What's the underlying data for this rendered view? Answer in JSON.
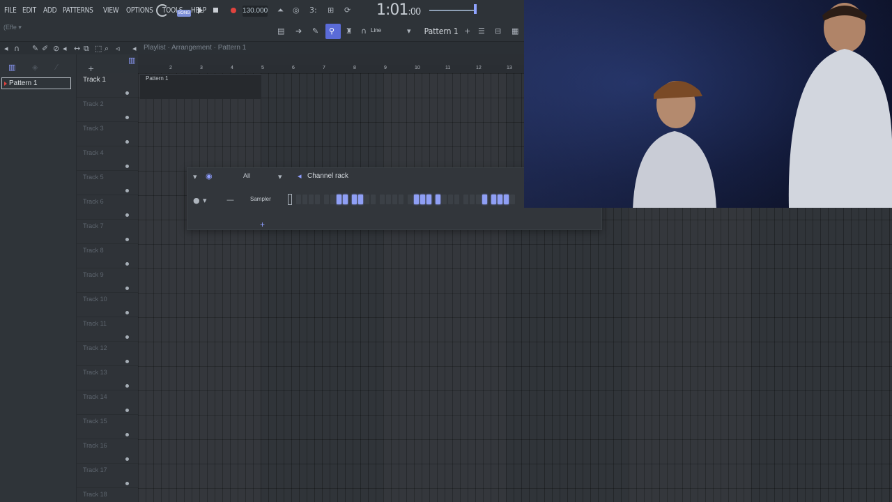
{
  "menu": [
    "FILE",
    "EDIT",
    "ADD",
    "PATTERNS",
    "VIEW",
    "OPTIONS",
    "TOOLS",
    "HELP"
  ],
  "transport": {
    "mode_label": "SONG",
    "tempo": "130.000",
    "time_main": "1:01",
    "time_sub": ":00"
  },
  "toolbar": {
    "snap_mode": "Line",
    "pattern_selected": "Pattern 1",
    "left_label": "(Effe ▾"
  },
  "playlist": {
    "breadcrumb": "Playlist · Arrangement · Pattern 1",
    "picker_item": "Pattern 1",
    "clip_label": "Pattern 1",
    "ruler": [
      "2",
      "3",
      "4",
      "5",
      "6",
      "7",
      "8",
      "9",
      "10",
      "11",
      "12",
      "13"
    ],
    "tracks": [
      "Track 1",
      "Track 2",
      "Track 3",
      "Track 4",
      "Track 5",
      "Track 6",
      "Track 7",
      "Track 8",
      "Track 9",
      "Track 10",
      "Track 11",
      "Track 12",
      "Track 13",
      "Track 14",
      "Track 15",
      "Track 16",
      "Track 17",
      "Track 18"
    ]
  },
  "channel_rack": {
    "title": "Channel rack",
    "filter": "All",
    "channel_name": "Sampler",
    "steps": [
      0,
      0,
      0,
      0,
      0,
      0,
      1,
      1,
      1,
      1,
      0,
      0,
      0,
      0,
      0,
      0,
      0,
      1,
      1,
      1,
      1,
      0,
      0,
      0,
      0,
      0,
      0,
      1,
      1,
      1,
      1,
      0
    ]
  },
  "colors": {
    "accent": "#8e9dff",
    "record": "#e0433e",
    "background": "#303439"
  }
}
